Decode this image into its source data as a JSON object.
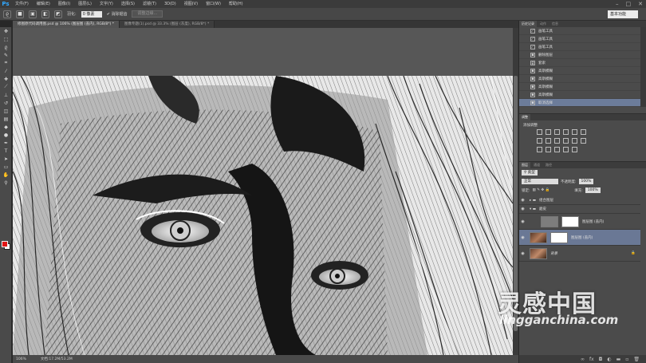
{
  "app": {
    "logo": "Ps"
  },
  "menu": [
    "文件(F)",
    "编辑(E)",
    "图像(I)",
    "图层(L)",
    "文字(Y)",
    "选择(S)",
    "滤镜(T)",
    "3D(D)",
    "视图(V)",
    "窗口(W)",
    "帮助(H)"
  ],
  "window_controls": [
    "–",
    "□",
    "✕"
  ],
  "options": {
    "feather_label": "羽化:",
    "feather_value": "0 像素",
    "antialias_label": "消除锯齿",
    "refine_button": "调整边缘...",
    "workspace": "基本功能"
  },
  "tabs": [
    {
      "label": "修图原代码调用图.psd @ 106% (图层图 (盖内), RGB/8*) *"
    },
    {
      "label": "图像专题(1).psd @ 33.3% (图层 (灰度), RGB/8*) *"
    }
  ],
  "status": {
    "zoom": "106%",
    "doc": "文档:17.2M/53.2M"
  },
  "panels": {
    "history_tabs": [
      "历史记录",
      "动作",
      "信息"
    ],
    "history": [
      {
        "label": "画笔工具",
        "icon": "brush"
      },
      {
        "label": "画笔工具",
        "icon": "brush"
      },
      {
        "label": "画笔工具",
        "icon": "brush"
      },
      {
        "label": "删除图层",
        "icon": "layer"
      },
      {
        "label": "套索",
        "icon": "lasso"
      },
      {
        "label": "高斯模糊",
        "icon": "layer"
      },
      {
        "label": "高斯模糊",
        "icon": "layer"
      },
      {
        "label": "高斯模糊",
        "icon": "layer"
      },
      {
        "label": "高斯模糊",
        "icon": "layer"
      },
      {
        "label": "取消选择",
        "icon": "layer"
      }
    ],
    "adjust_tab": "调整",
    "adjust_title": "添加调整",
    "layers_tabs": [
      "图层",
      "通道",
      "路径"
    ],
    "kind_label": "类型",
    "blend_mode": "正常",
    "opacity_label": "不透明度:",
    "opacity": "100%",
    "lock_label": "锁定:",
    "fill_label": "填充:",
    "fill": "100%",
    "layers": [
      {
        "name": "组合图层",
        "type": "group"
      },
      {
        "name": "磨皮",
        "type": "group"
      },
      {
        "name": "图层图 (盖内)",
        "type": "mask"
      },
      {
        "name": "图层图 (盖内)",
        "type": "photo",
        "selected": true
      },
      {
        "name": "背景",
        "type": "bg"
      }
    ]
  },
  "watermark": {
    "cn": "灵感中国",
    "en": "lingganchina.com"
  },
  "colors": {
    "foreground": "#e01515",
    "background": "#ffffff",
    "accent": "#31a8ff"
  }
}
